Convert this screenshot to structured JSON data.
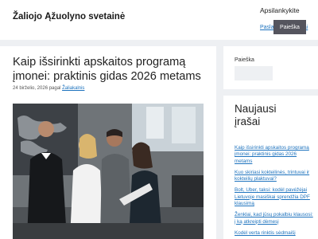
{
  "header": {
    "site_title": "Žaliojo Ąžuolyno svetainė",
    "nav_primary": "Apsilankykite",
    "nav_secondary": "Paslaugų skelbimai"
  },
  "post": {
    "title": "Kaip išsirinkti apskaitos programą įmonei: praktinis gidas 2026 metams",
    "date": "24 birželio, 2026",
    "by": "pagal",
    "author": "Žaliakalnis"
  },
  "search": {
    "label": "Paieška",
    "button_label": "Paieška",
    "placeholder": ""
  },
  "recent": {
    "heading": "Naujausi įrašai",
    "items": [
      "Kaip išsirinkti apskaitos programą įmonei: praktinis gidas 2026 metams",
      "Kuo skiriasi kokteilinės, trintuvai ir kokteilių plaktuvai?",
      "Bolt, Uber, taksi: kodėl pavėžėjai Lietuvoje masiškai sprendžia DPF klausimą",
      "Ženklai, kad jūsų pokalbiu klausosi: į ką atkreipti dėmesį",
      "Kodėl verta rinktis sėdmaišį"
    ]
  }
}
